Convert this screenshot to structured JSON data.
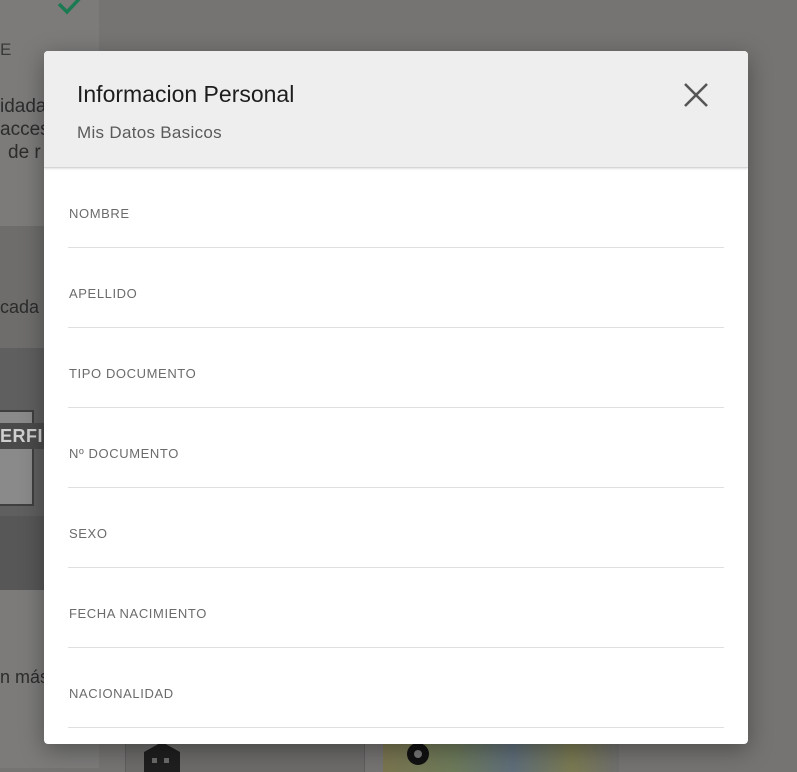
{
  "background": {
    "letter": "E",
    "text_lines": [
      "idada",
      "acces",
      "de r"
    ],
    "text_lines_lower": [
      "cada",
      "n más"
    ],
    "stripe_text": "ERFI"
  },
  "modal": {
    "title": "Informacion Personal",
    "subtitle": "Mis Datos Basicos",
    "close_icon": "close-icon",
    "fields": [
      {
        "label": "NOMBRE",
        "value": ""
      },
      {
        "label": "APELLIDO",
        "value": ""
      },
      {
        "label": "TIPO DOCUMENTO",
        "value": ""
      },
      {
        "label": "Nº DOCUMENTO",
        "value": ""
      },
      {
        "label": "SEXO",
        "value": ""
      },
      {
        "label": "FECHA NACIMIENTO",
        "value": ""
      },
      {
        "label": "NACIONALIDAD",
        "value": ""
      }
    ]
  },
  "colors": {
    "overlay": "#767473",
    "header_bg": "#efeeee",
    "check_green": "#1b7a52"
  }
}
